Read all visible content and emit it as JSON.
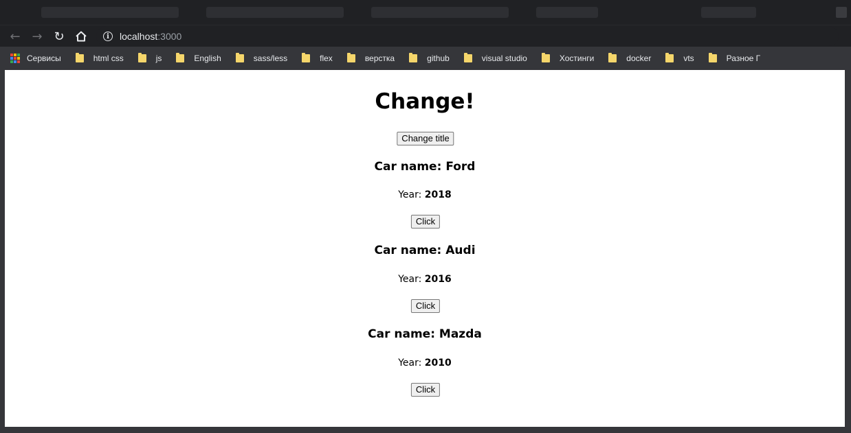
{
  "browser": {
    "url_host": "localhost",
    "url_port": ":3000"
  },
  "bookmarks": {
    "apps_label": "Сервисы",
    "items": [
      {
        "label": "html css"
      },
      {
        "label": "js"
      },
      {
        "label": "English"
      },
      {
        "label": "sass/less"
      },
      {
        "label": "flex"
      },
      {
        "label": "верстка"
      },
      {
        "label": "github"
      },
      {
        "label": "visual studio"
      },
      {
        "label": "Хостинги"
      },
      {
        "label": "docker"
      },
      {
        "label": "vts"
      },
      {
        "label": "Разное Г"
      }
    ]
  },
  "page": {
    "title": "Change!",
    "change_button": "Change title",
    "cars": [
      {
        "name_prefix": "Car name: ",
        "name": "Ford",
        "year_label": "Year: ",
        "year": "2018",
        "button": "Click"
      },
      {
        "name_prefix": "Car name: ",
        "name": "Audi",
        "year_label": "Year: ",
        "year": "2016",
        "button": "Click"
      },
      {
        "name_prefix": "Car name: ",
        "name": "Mazda",
        "year_label": "Year: ",
        "year": "2010",
        "button": "Click"
      }
    ]
  },
  "icons": {
    "back": "arrow-left-icon",
    "forward": "arrow-right-icon",
    "reload": "reload-icon",
    "home": "home-icon",
    "site_info": "info-icon",
    "apps": "apps-grid-icon",
    "bookmark_folder": "folder-icon"
  },
  "colors": {
    "browser_chrome": "#202124",
    "bookmark_bar": "#35363a",
    "folder": "#f5d66b",
    "page_bg": "#ffffff"
  }
}
